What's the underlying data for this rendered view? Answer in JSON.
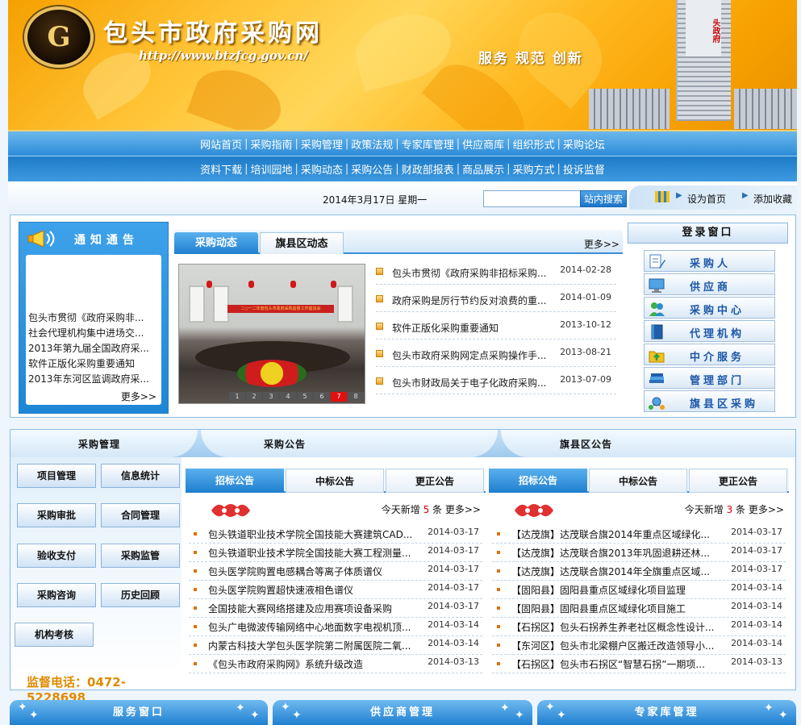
{
  "colors": {
    "nav_blue": "#2c8cd8",
    "accent_orange": "#f5a000",
    "highlight_red": "#e00000",
    "hotline_orange": "#e08a00"
  },
  "header": {
    "logo_glyph": "G",
    "title": "包头市政府采购网",
    "url": "http://www.btzfcg.gov.cn/",
    "slogan": "服务  规范  创新",
    "tower_sign": "头政府"
  },
  "nav": {
    "row1": [
      "网站首页",
      "采购指南",
      "采购管理",
      "政策法规",
      "专家库管理",
      "供应商库",
      "组织形式",
      "采购论坛"
    ],
    "row2": [
      "资料下载",
      "培训园地",
      "采购动态",
      "采购公告",
      "财政部报表",
      "商品展示",
      "采购方式",
      "投诉监督"
    ],
    "separator": "|"
  },
  "toolbar": {
    "date": "2014年3月17日 星期一",
    "search_placeholder": "",
    "search_button": "站内搜索",
    "set_home": "设为首页",
    "add_favorite": "添加收藏",
    "arrow_icon": "▶"
  },
  "notice": {
    "title": "通知通告",
    "items": [
      "包头市贯彻《政府采购非...",
      "社会代理机构集中进场交...",
      "2013年第九届全国政府采...",
      "软件正版化采购重要通知",
      "2013年东河区监调政府采..."
    ],
    "more": "更多>>"
  },
  "news": {
    "tabs": [
      "采购动态",
      "旗县区动态"
    ],
    "more": "更多>>",
    "photo_caption": "二○一二年度包头市政府采购监督工作座谈会",
    "pager": [
      "1",
      "2",
      "3",
      "4",
      "5",
      "6",
      "7",
      "8"
    ],
    "pager_active": 6,
    "items": [
      {
        "title": "包头市贯彻《政府采购非招标采购...",
        "date": "2014-02-28"
      },
      {
        "title": "政府采购是厉行节约反对浪费的重...",
        "date": "2014-01-09"
      },
      {
        "title": "软件正版化采购重要通知",
        "date": "2013-10-12"
      },
      {
        "title": "包头市政府采购网定点采购操作手...",
        "date": "2013-08-21"
      },
      {
        "title": "包头市财政局关于电子化政府采购...",
        "date": "2013-07-09"
      }
    ]
  },
  "login": {
    "title": "登录窗口",
    "items": [
      {
        "label": "采购人",
        "icon": "document-pen-icon"
      },
      {
        "label": "供应商",
        "icon": "monitor-icon"
      },
      {
        "label": "采购中心",
        "icon": "people-icon"
      },
      {
        "label": "代理机构",
        "icon": "book-icon"
      },
      {
        "label": "中介服务",
        "icon": "folder-upload-icon"
      },
      {
        "label": "管理部门",
        "icon": "stacked-books-icon"
      },
      {
        "label": "旗县区采购",
        "icon": "network-icon"
      }
    ]
  },
  "section_heads": {
    "management": "采购管理",
    "announcements": "采购公告",
    "county_announcements": "旗县区公告"
  },
  "management": {
    "buttons": [
      "项目管理",
      "信息统计",
      "采购审批",
      "合同管理",
      "验收支付",
      "采购监管",
      "采购咨询",
      "历史回顾",
      "机构考核"
    ],
    "hotline": "监督电话：0472-5228698"
  },
  "announcements": {
    "tabs": [
      "招标公告",
      "中标公告",
      "更正公告"
    ],
    "summary_prefix": "今天新增",
    "summary_count": "5",
    "summary_suffix": "条",
    "more": "更多>>",
    "items": [
      {
        "title": "包头铁道职业技术学院全国技能大赛建筑CAD...",
        "date": "2014-03-17"
      },
      {
        "title": "包头铁道职业技术学院全国技能大赛工程测量...",
        "date": "2014-03-17"
      },
      {
        "title": "包头医学院购置电感耦合等离子体质谱仪",
        "date": "2014-03-17"
      },
      {
        "title": "包头医学院购置超快速液相色谱仪",
        "date": "2014-03-17"
      },
      {
        "title": "全国技能大赛网络搭建及应用赛项设备采购",
        "date": "2014-03-17"
      },
      {
        "title": "包头广电微波传输网络中心地面数字电视机顶...",
        "date": "2014-03-14"
      },
      {
        "title": "内蒙古科技大学包头医学院第二附属医院二氧...",
        "date": "2014-03-14"
      },
      {
        "title": "《包头市政府采购网》系统升级改造",
        "date": "2014-03-13"
      }
    ]
  },
  "county": {
    "tabs": [
      "招标公告",
      "中标公告",
      "更正公告"
    ],
    "summary_prefix": "今天新增",
    "summary_count": "3",
    "summary_suffix": "条",
    "more": "更多>>",
    "items": [
      {
        "title": "【达茂旗】达茂联合旗2014年重点区域绿化...",
        "date": "2014-03-17"
      },
      {
        "title": "【达茂旗】达茂联合旗2013年巩固退耕还林...",
        "date": "2014-03-17"
      },
      {
        "title": "【达茂旗】达茂联合旗2014年全旗重点区域...",
        "date": "2014-03-17"
      },
      {
        "title": "【固阳县】固阳县重点区域绿化项目监理",
        "date": "2014-03-14"
      },
      {
        "title": "【固阳县】固阳县重点区域绿化项目施工",
        "date": "2014-03-14"
      },
      {
        "title": "【石拐区】包头石拐养生养老社区概念性设计...",
        "date": "2014-03-14"
      },
      {
        "title": "【东河区】包头市北梁棚户区搬迁改造领导小...",
        "date": "2014-03-14"
      },
      {
        "title": "【石拐区】包头市石拐区“智慧石拐”一期项...",
        "date": "2014-03-13"
      }
    ]
  },
  "bottom": [
    "服务窗口",
    "供应商管理",
    "专家库管理"
  ]
}
